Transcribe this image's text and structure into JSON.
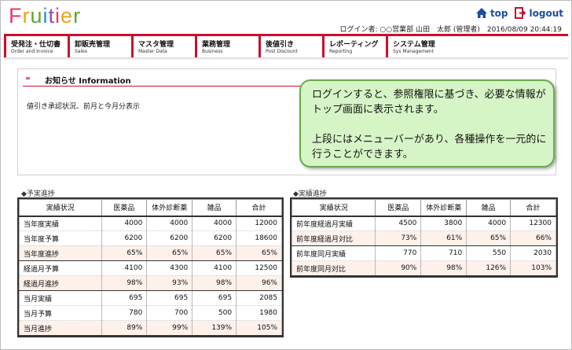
{
  "header": {
    "logo_letters": [
      {
        "ch": "F",
        "color": "#e23c6b"
      },
      {
        "ch": "r",
        "color": "#e8a41c"
      },
      {
        "ch": "u",
        "color": "#5aa832"
      },
      {
        "ch": "i",
        "color": "#2a8fcf"
      },
      {
        "ch": "t",
        "color": "#8b4fb0"
      },
      {
        "ch": "i",
        "color": "#e23c6b"
      },
      {
        "ch": "e",
        "color": "#e8a41c"
      },
      {
        "ch": "r",
        "color": "#5aa832"
      }
    ],
    "top_label": "top",
    "logout_label": "logout",
    "user_line": "ログイン者: ○○営業部 山田　太郎 (管理者)　2016/08/09 20:44:19"
  },
  "menu": [
    {
      "jp": "受発注・仕切書",
      "en": "Order and Invoice"
    },
    {
      "jp": "卸販売管理",
      "en": "Sales"
    },
    {
      "jp": "マスタ管理",
      "en": "Master Data"
    },
    {
      "jp": "業務管理",
      "en": "Business"
    },
    {
      "jp": "後値引き",
      "en": "Post Discount"
    },
    {
      "jp": "レポーティング",
      "en": "Reporting"
    },
    {
      "jp": "システム管理",
      "en": "Sys Management"
    }
  ],
  "notice": {
    "bullet": "≡",
    "title": "お知らせ Information",
    "body": "値引き承認状況、前月と今月分表示"
  },
  "callout": {
    "line1": "ログインすると、参照権限に基づき、必要な情報がトップ画面に表示されます。",
    "line2": "上段にはメニューバーがあり、各種操作を一元的に行うことができます。"
  },
  "progress": {
    "title": "◆予実進捗",
    "headers": [
      "実績状況",
      "医薬品",
      "体外診断薬",
      "雑品",
      "合計"
    ],
    "rows": [
      {
        "label": "当年度実績",
        "values": [
          "4000",
          "4000",
          "4000",
          "12000"
        ],
        "pct": false,
        "end": false
      },
      {
        "label": "当年度予算",
        "values": [
          "6200",
          "6200",
          "6200",
          "18600"
        ],
        "pct": false,
        "end": false
      },
      {
        "label": "当年度進捗",
        "values": [
          "65%",
          "65%",
          "65%",
          "65%"
        ],
        "pct": true,
        "end": true
      },
      {
        "label": "経過月予算",
        "values": [
          "4100",
          "4300",
          "4100",
          "12500"
        ],
        "pct": false,
        "end": false
      },
      {
        "label": "経過月進捗",
        "values": [
          "98%",
          "93%",
          "98%",
          "96%"
        ],
        "pct": true,
        "end": true
      },
      {
        "label": "当月実績",
        "values": [
          "695",
          "695",
          "695",
          "2085"
        ],
        "pct": false,
        "end": false
      },
      {
        "label": "当月予算",
        "values": [
          "780",
          "700",
          "500",
          "1980"
        ],
        "pct": false,
        "end": false
      },
      {
        "label": "当月進捗",
        "values": [
          "89%",
          "99%",
          "139%",
          "105%"
        ],
        "pct": true,
        "end": true
      }
    ]
  },
  "results": {
    "title": "◆実績進捗",
    "headers": [
      "実績状況",
      "医薬品",
      "体外診断薬",
      "雑品",
      "合計"
    ],
    "rows": [
      {
        "label": "前年度経過月実績",
        "values": [
          "4500",
          "3800",
          "4000",
          "12300"
        ],
        "pct": false,
        "end": false
      },
      {
        "label": "前年度経過月対比",
        "values": [
          "73%",
          "61%",
          "65%",
          "66%"
        ],
        "pct": true,
        "end": true
      },
      {
        "label": "前年度同月実績",
        "values": [
          "770",
          "710",
          "550",
          "2030"
        ],
        "pct": false,
        "end": false
      },
      {
        "label": "前年度同月対比",
        "values": [
          "90%",
          "98%",
          "126%",
          "103%"
        ],
        "pct": true,
        "end": true
      }
    ]
  }
}
